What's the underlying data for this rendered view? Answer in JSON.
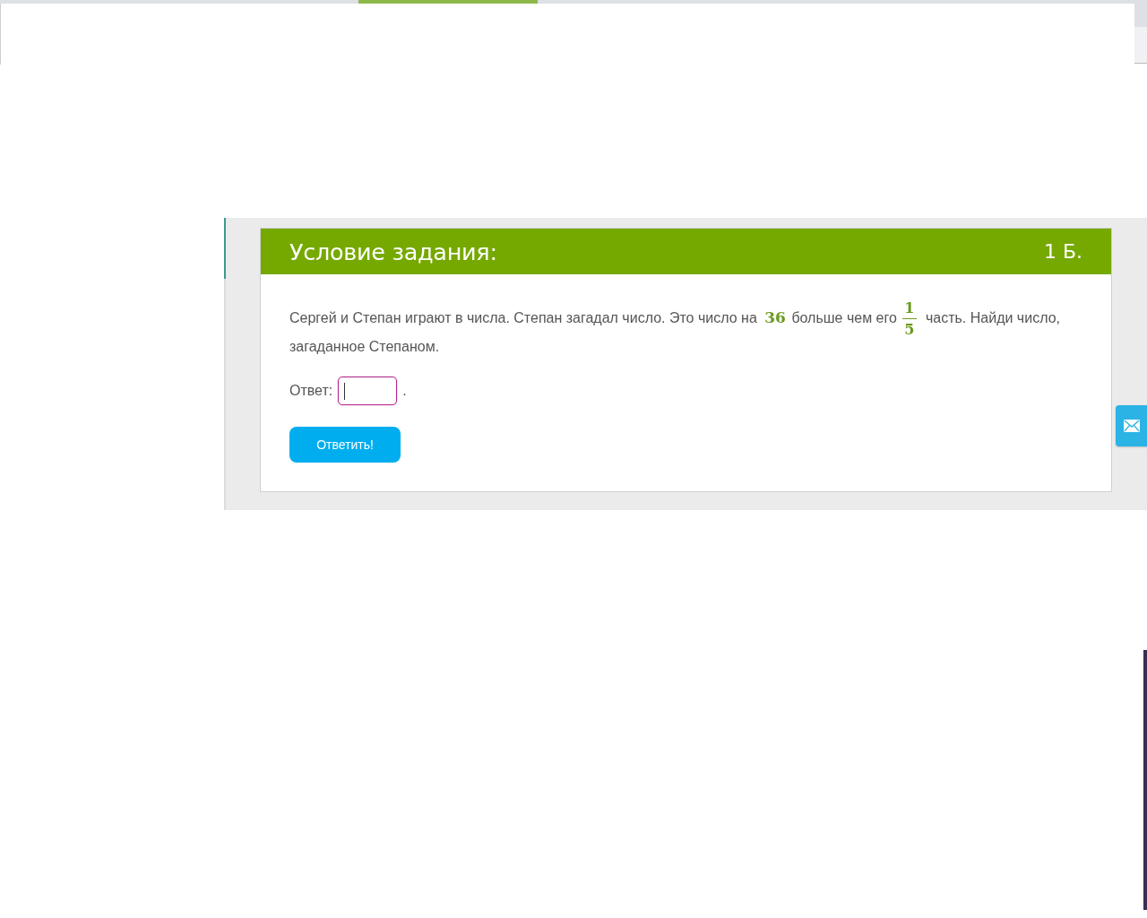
{
  "task": {
    "title": "Условие задания:",
    "score": "1 Б.",
    "problem": [
      {
        "kind": "text",
        "text": "Сергей и Степан играют в числа. Степан загадал число. Это число на"
      },
      {
        "kind": "number",
        "text": "36"
      },
      {
        "kind": "text",
        "text": "больше чем его"
      },
      {
        "kind": "fraction",
        "numerator": "1",
        "denominator": "5"
      },
      {
        "kind": "text",
        "text": "часть. Найди число, загаданное Степаном."
      }
    ],
    "answer": {
      "label": "Ответ:",
      "focused": true,
      "suffix": "."
    },
    "submit": "Ответить!"
  }
}
